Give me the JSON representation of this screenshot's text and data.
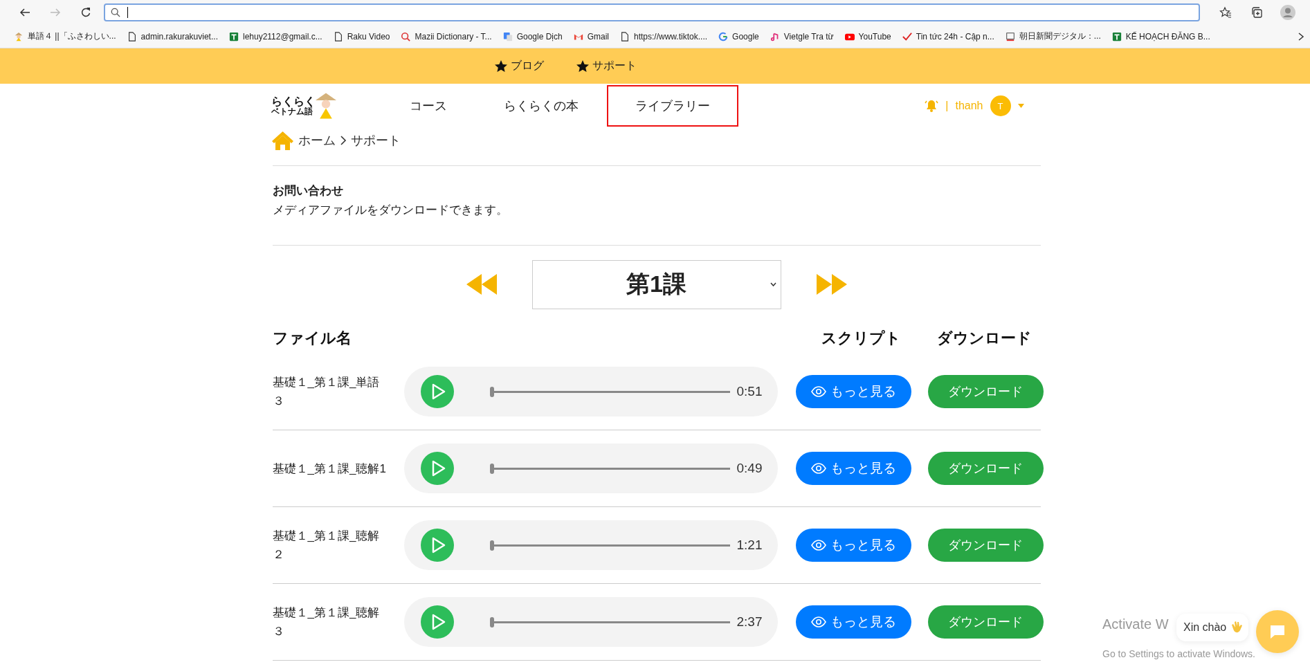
{
  "browser": {
    "forward_disabled": true,
    "bookmarks": [
      {
        "label": "単語４ ||「ふさわしい...",
        "kind": "mascot"
      },
      {
        "label": "admin.rakurakuviet...",
        "kind": "page"
      },
      {
        "label": "lehuy2112@gmail.c...",
        "kind": "sheet"
      },
      {
        "label": "Raku Video",
        "kind": "page"
      },
      {
        "label": "Mazii Dictionary - T...",
        "kind": "mazii"
      },
      {
        "label": "Google Dịch",
        "kind": "translate"
      },
      {
        "label": "Gmail",
        "kind": "gmail"
      },
      {
        "label": "https://www.tiktok....",
        "kind": "page"
      },
      {
        "label": "Google",
        "kind": "google"
      },
      {
        "label": "Vietgle Tra từ",
        "kind": "vietgle"
      },
      {
        "label": "YouTube",
        "kind": "youtube"
      },
      {
        "label": "Tin tức 24h - Cập n...",
        "kind": "tick"
      },
      {
        "label": "朝日新聞デジタル：...",
        "kind": "kanji"
      },
      {
        "label": "KẾ HOẠCH ĐĂNG B...",
        "kind": "sheet"
      }
    ]
  },
  "top_links": [
    {
      "label": "ブログ"
    },
    {
      "label": "サポート"
    }
  ],
  "nav": [
    {
      "label": "コース",
      "selected": false
    },
    {
      "label": "らくらくの本",
      "selected": false
    },
    {
      "label": "ライブラリー",
      "selected": true
    }
  ],
  "logo": {
    "line1": "らくらく",
    "line2": "ベトナム語"
  },
  "user": {
    "separator": "|",
    "name": "thanh",
    "initial": "T"
  },
  "breadcrumb": [
    "ホーム",
    "サポート"
  ],
  "section": {
    "title": "お問い合わせ",
    "description": "メディアファイルをダウンロードできます。"
  },
  "lesson_select": {
    "value": "第1課"
  },
  "columns": [
    "ファイル名",
    "スクリプト",
    "ダウンロード"
  ],
  "rows": [
    {
      "name": "基礎１_第１課_単語３",
      "level": 0,
      "duration": "0:51",
      "script_button": "もっと見る",
      "download_button": "ダウンロード"
    },
    {
      "name": "基礎１_第１課_聴解1",
      "level": 0,
      "duration": "0:49",
      "script_button": "もっと見る",
      "download_button": "ダウンロード"
    },
    {
      "name": "基礎１_第１課_聴解２",
      "level": 0,
      "duration": "1:21",
      "script_button": "もっと見る",
      "download_button": "ダウンロード"
    },
    {
      "name": "基礎１_第１課_聴解３",
      "level": 0,
      "duration": "2:37",
      "script_button": "もっと見る",
      "download_button": "ダウンロード"
    }
  ],
  "system_notice": {
    "title": "Activate W",
    "subtitle": "Go to Settings to activate Windows."
  },
  "chat": {
    "greeting": "Xin chào"
  }
}
